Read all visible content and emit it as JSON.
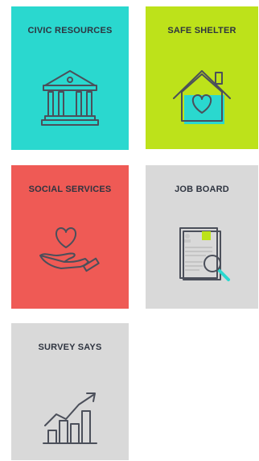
{
  "tiles": [
    {
      "label": "CIVIC RESOURCES",
      "icon": "courthouse-icon",
      "color": "#2ad8cf"
    },
    {
      "label": "SAFE SHELTER",
      "icon": "house-heart-icon",
      "color": "#bde21a"
    },
    {
      "label": "SOCIAL SERVICES",
      "icon": "hand-heart-icon",
      "color": "#ef5a55"
    },
    {
      "label": "JOB BOARD",
      "icon": "resume-magnifier-icon",
      "color": "#d9d9d9"
    },
    {
      "label": "SURVEY SAYS",
      "icon": "bar-chart-growth-icon",
      "color": "#d9d9d9"
    }
  ]
}
